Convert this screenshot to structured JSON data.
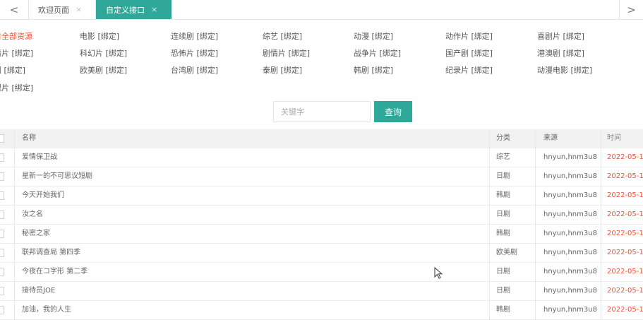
{
  "tabs": {
    "left_arrow": "<",
    "right_arrow": ">",
    "items": [
      {
        "label": "欢迎页面",
        "close": "×"
      },
      {
        "label": "自定义接口",
        "close": "×"
      }
    ]
  },
  "categories": [
    "看全部资源",
    "电影 [绑定]",
    "连续剧 [绑定]",
    "综艺 [绑定]",
    "动漫 [绑定]",
    "动作片 [绑定]",
    "喜剧片 [绑定]",
    "情片 [绑定]",
    "科幻片 [绑定]",
    "恐怖片 [绑定]",
    "剧情片 [绑定]",
    "战争片 [绑定]",
    "国产剧 [绑定]",
    "港澳剧 [绑定]",
    "剧 [绑定]",
    "欧美剧 [绑定]",
    "台湾剧 [绑定]",
    "泰剧 [绑定]",
    "韩剧 [绑定]",
    "纪录片 [绑定]",
    "动漫电影 [绑定]",
    "理片 [绑定]"
  ],
  "search": {
    "placeholder": "关键字",
    "button": "查询"
  },
  "table": {
    "headers": {
      "name": "名称",
      "type": "分类",
      "source": "来源",
      "time": "时间"
    },
    "rows": [
      {
        "name": "爱情保卫战",
        "type": "综艺",
        "source": "hnyun,hnm3u8",
        "time": "2022-05-1"
      },
      {
        "name": "星新一的不可思议短剧",
        "type": "日剧",
        "source": "hnyun,hnm3u8",
        "time": "2022-05-1"
      },
      {
        "name": "今天开始我们",
        "type": "韩剧",
        "source": "hnyun,hnm3u8",
        "time": "2022-05-1"
      },
      {
        "name": "汝之名",
        "type": "日剧",
        "source": "hnyun,hnm3u8",
        "time": "2022-05-1"
      },
      {
        "name": "秘密之家",
        "type": "韩剧",
        "source": "hnyun,hnm3u8",
        "time": "2022-05-1"
      },
      {
        "name": "联邦调查局 第四季",
        "type": "欧美剧",
        "source": "hnyun,hnm3u8",
        "time": "2022-05-1"
      },
      {
        "name": "今夜在コ字形 第二季",
        "type": "日剧",
        "source": "hnyun,hnm3u8",
        "time": "2022-05-1"
      },
      {
        "name": "接待员JOE",
        "type": "日剧",
        "source": "hnyun,hnm3u8",
        "time": "2022-05-1"
      },
      {
        "name": "加油，我的人生",
        "type": "韩剧",
        "source": "hnyun,hnm3u8",
        "time": "2022-05-1"
      }
    ]
  },
  "colors": {
    "accent": "#2fa89a",
    "active_link": "#e8553c",
    "time_text": "#e8553c"
  }
}
